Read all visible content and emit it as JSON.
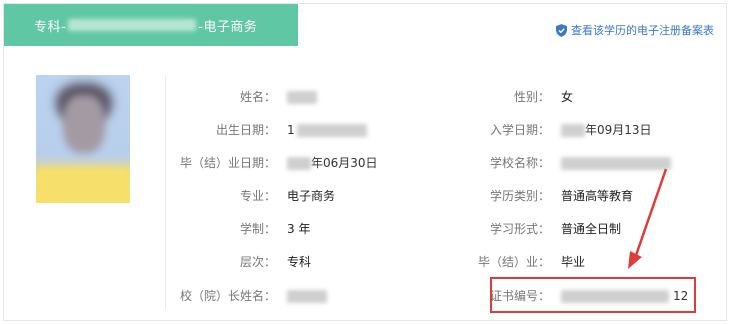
{
  "header": {
    "tab_prefix": "专科-",
    "tab_suffix": "-电子商务",
    "verify_link": "查看该学历的电子注册备案表"
  },
  "fields_left": [
    {
      "label": "姓名：",
      "value": ""
    },
    {
      "label": "出生日期：",
      "value": "1"
    },
    {
      "label": "毕（结）业日期：",
      "value": "年06月30日"
    },
    {
      "label": "专业：",
      "value": "电子商务"
    },
    {
      "label": "学制：",
      "value": "3 年"
    },
    {
      "label": "层次：",
      "value": "专科"
    },
    {
      "label": "校（院）长姓名：",
      "value": ""
    }
  ],
  "fields_right": [
    {
      "label": "性别：",
      "value": "女"
    },
    {
      "label": "入学日期：",
      "value": "年09月13日"
    },
    {
      "label": "学校名称：",
      "value": ""
    },
    {
      "label": "学历类别：",
      "value": "普通高等教育"
    },
    {
      "label": "学习形式：",
      "value": "普通全日制"
    },
    {
      "label": "毕（结）业：",
      "value": "毕业"
    },
    {
      "label": "证书编号：",
      "value": "12"
    }
  ],
  "colors": {
    "tab_bg": "#60c7a5",
    "link": "#3a78c9",
    "highlight": "#e03b3b"
  },
  "icons": {
    "verify": "shield-check-icon"
  }
}
